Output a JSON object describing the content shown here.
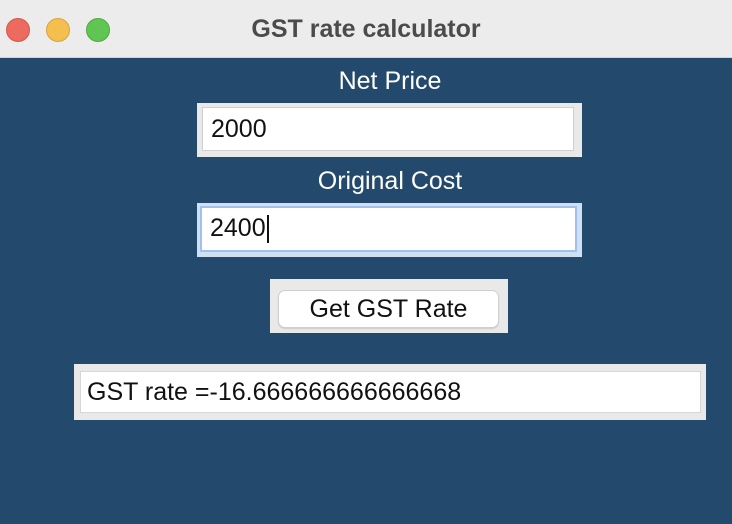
{
  "window": {
    "title": "GST rate calculator",
    "colors": {
      "background": "#234a6c",
      "titlebar": "#ececec",
      "close": "#ec6a5e",
      "minimize": "#f4bf4f",
      "zoom": "#61c554"
    }
  },
  "form": {
    "net_price_label": "Net Price",
    "net_price_value": "2000",
    "original_cost_label": "Original Cost",
    "original_cost_value": "2400",
    "button_label": "Get GST Rate"
  },
  "result": {
    "text": "GST rate =-16.666666666666668"
  }
}
